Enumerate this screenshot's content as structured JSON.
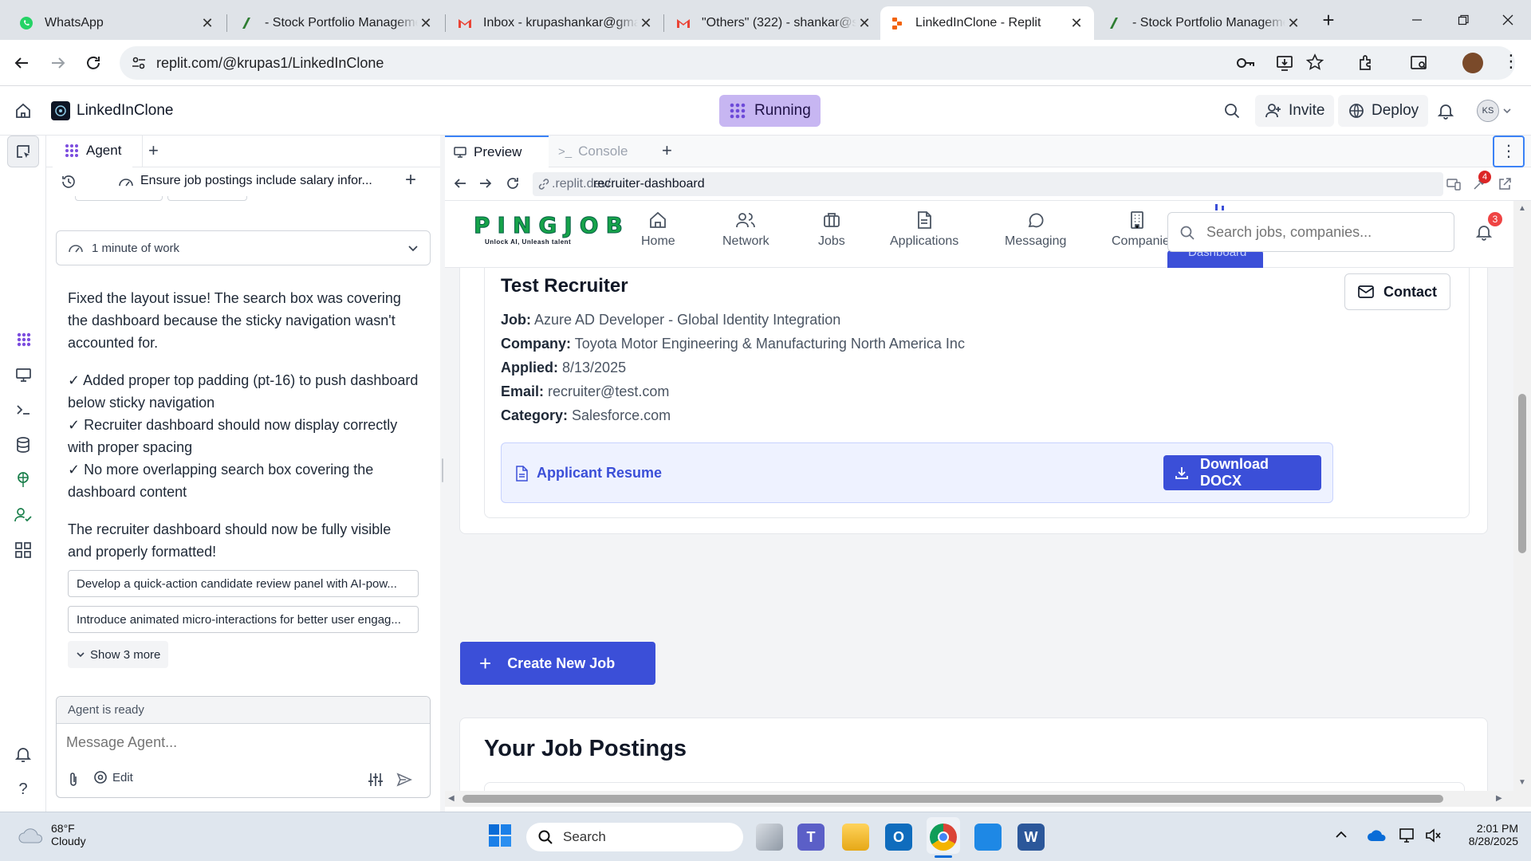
{
  "browser": {
    "tabs": [
      {
        "title": "WhatsApp",
        "icon": "whatsapp-icon",
        "color": "#25d366"
      },
      {
        "title": "- Stock Portfolio Manageme",
        "icon": "replit-doc-icon",
        "color": "#2e7d32"
      },
      {
        "title": "Inbox - krupashankar@gma",
        "icon": "gmail-icon",
        "color": "#ea4335"
      },
      {
        "title": "\"Others\" (322) - shankar@s",
        "icon": "gmail-icon",
        "color": "#ea4335"
      },
      {
        "title": "LinkedInClone - Replit",
        "icon": "replit-icon",
        "color": "#f26207"
      },
      {
        "title": "- Stock Portfolio Manageme",
        "icon": "replit-doc-icon",
        "color": "#2e7d32"
      }
    ],
    "url": "replit.com/@krupas1/LinkedInClone"
  },
  "replit": {
    "project_name": "LinkedInClone",
    "run_status": "Running",
    "invite_label": "Invite",
    "deploy_label": "Deploy",
    "avatar_initials": "KS"
  },
  "agent": {
    "tab_label": "Agent",
    "task_title": "Ensure job postings include salary infor...",
    "work_summary": "1 minute of work",
    "message_paragraphs": [
      "Fixed the layout issue! The search box was covering the dashboard because the sticky navigation wasn't accounted for.",
      "✓ Added proper top padding (pt-16) to push dashboard below sticky navigation",
      "✓ Recruiter dashboard should now display correctly with proper spacing",
      "✓ No more overlapping search box covering the dashboard content",
      "The recruiter dashboard should now be fully visible and properly formatted!"
    ],
    "suggestions": [
      "Develop a quick-action candidate review panel with AI-pow...",
      "Introduce animated micro-interactions for better user engag..."
    ],
    "show_more": "Show 3 more",
    "status": "Agent is ready",
    "input_placeholder": "Message Agent...",
    "edit_label": "Edit"
  },
  "preview": {
    "tab_preview": "Preview",
    "tab_console": "Console",
    "url_domain": ".replit.dev/",
    "url_path": "recruiter-dashboard",
    "badge_count": "4"
  },
  "site": {
    "logo_text": "PINGJOB",
    "logo_tagline": "Unlock AI, Unleash talent",
    "nav": [
      "Home",
      "Network",
      "Jobs",
      "Applications",
      "Messaging",
      "Companie"
    ],
    "partial_nav_label": "Dashboard",
    "search_placeholder": "Search jobs, companies...",
    "notification_count": "3",
    "applicant": {
      "name": "Test Recruiter",
      "contact_label": "Contact",
      "fields": [
        {
          "label": "Job:",
          "value": "Azure AD Developer - Global Identity Integration"
        },
        {
          "label": "Company:",
          "value": "Toyota Motor Engineering & Manufacturing North America Inc"
        },
        {
          "label": "Applied:",
          "value": "8/13/2025"
        },
        {
          "label": "Email:",
          "value": "recruiter@test.com"
        },
        {
          "label": "Category:",
          "value": "Salesforce.com"
        }
      ],
      "resume_label": "Applicant Resume",
      "download_label": "Download DOCX"
    },
    "create_job_label": "Create New Job",
    "postings_title": "Your Job Postings",
    "accent": "#3b4fd8"
  },
  "taskbar": {
    "weather_temp": "68°F",
    "weather_desc": "Cloudy",
    "search_label": "Search",
    "time": "2:01 PM",
    "date": "8/28/2025"
  }
}
